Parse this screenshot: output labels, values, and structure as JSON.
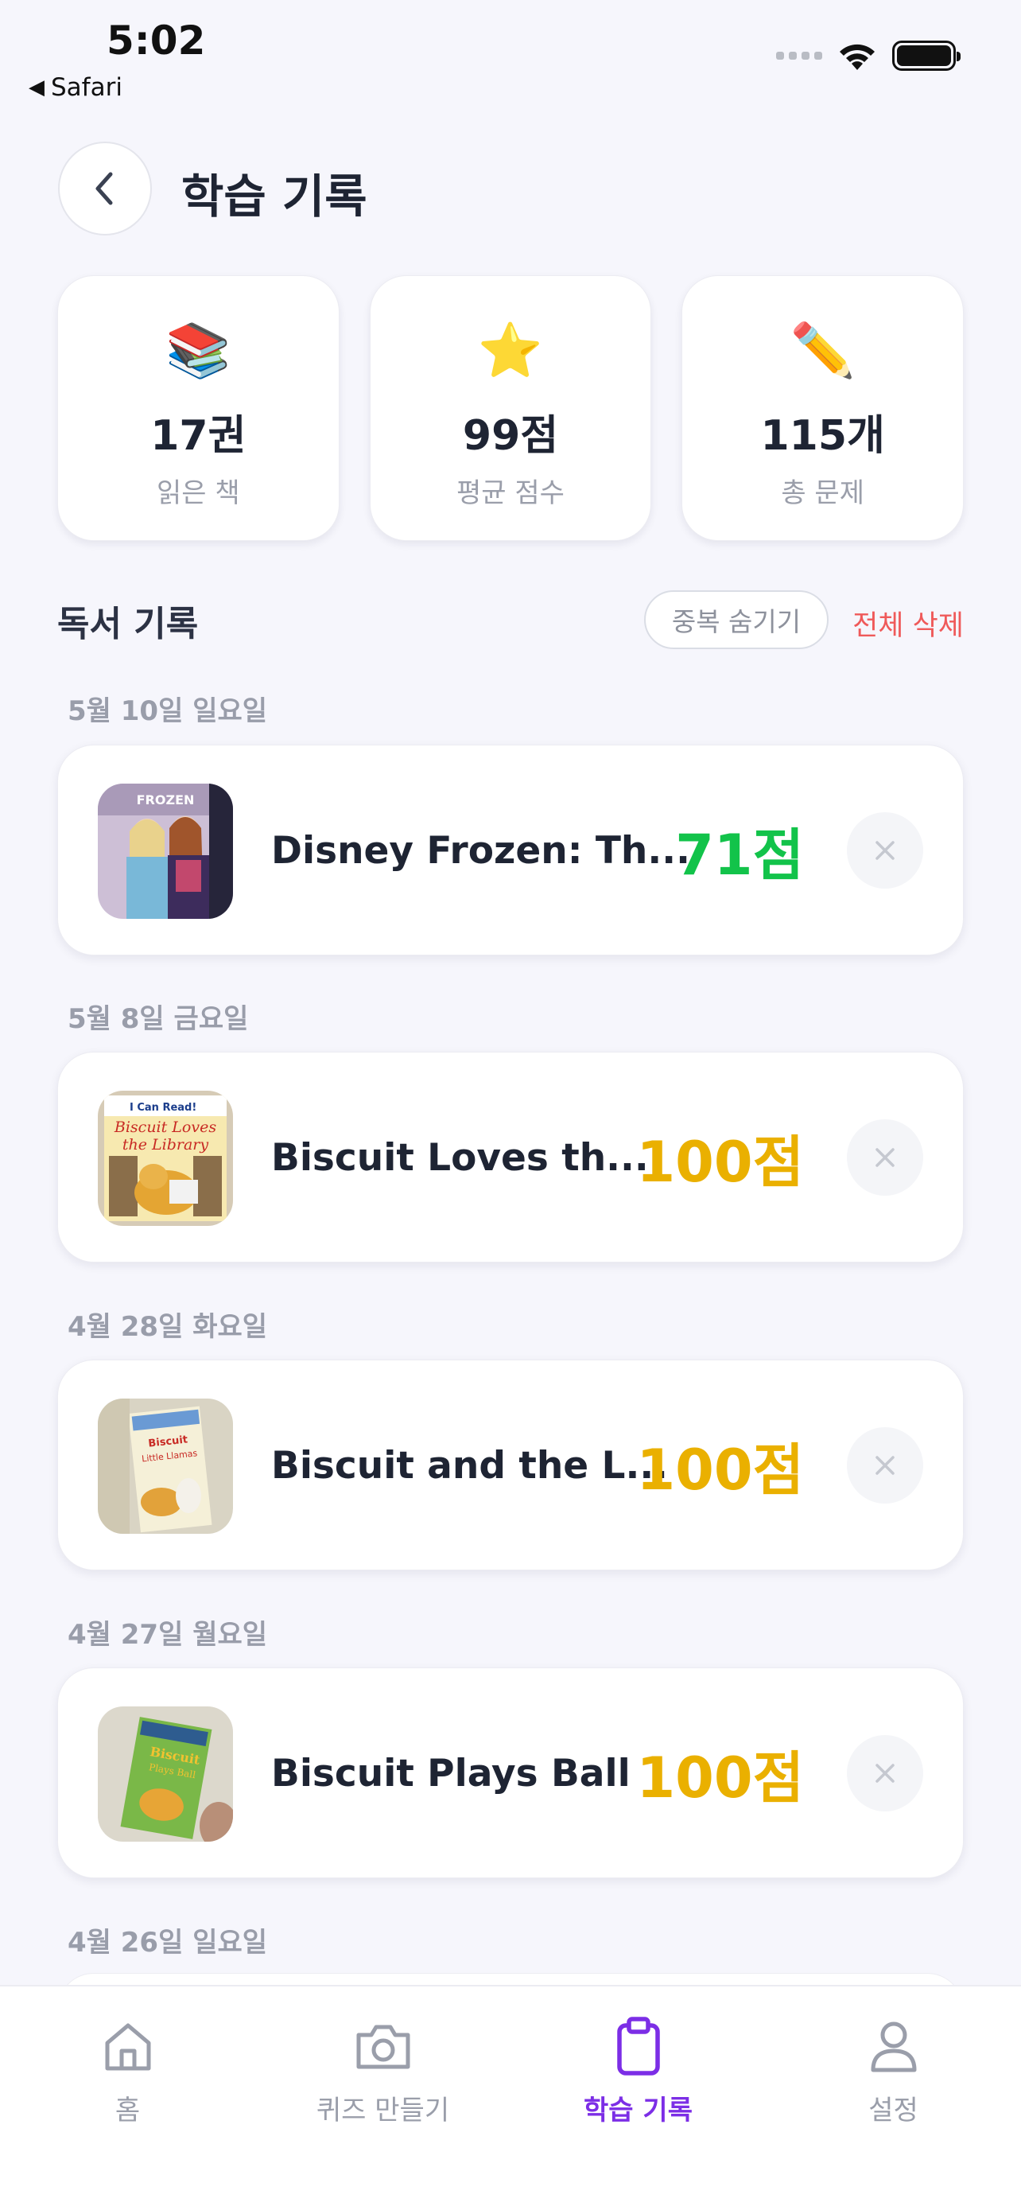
{
  "status_bar": {
    "time": "5:02",
    "back_app": "Safari"
  },
  "header": {
    "title": "학습 기록"
  },
  "stats": [
    {
      "icon": "books-icon",
      "emoji": "📚",
      "value": "17권",
      "label": "읽은 책"
    },
    {
      "icon": "star-icon",
      "emoji": "⭐",
      "value": "99점",
      "label": "평균 점수"
    },
    {
      "icon": "pencil-icon",
      "emoji": "✏️",
      "value": "115개",
      "label": "총 문제"
    }
  ],
  "section": {
    "title": "독서 기록",
    "hide_duplicates": "중복 숨기기",
    "delete_all": "전체 삭제"
  },
  "records": [
    {
      "date": "5월 10일 일요일",
      "title": "Disney Frozen: Th...",
      "score": "71점",
      "score_color": "#12c34a"
    },
    {
      "date": "5월 8일 금요일",
      "title": "Biscuit Loves th...",
      "score": "100점",
      "score_color": "#eab000"
    },
    {
      "date": "4월 28일 화요일",
      "title": "Biscuit and the L...",
      "score": "100점",
      "score_color": "#eab000"
    },
    {
      "date": "4월 27일 월요일",
      "title": "Biscuit Plays Ball",
      "score": "100점",
      "score_color": "#eab000"
    },
    {
      "date": "4월 26일 일요일"
    }
  ],
  "tabs": [
    {
      "label": "홈",
      "icon": "home-icon",
      "active": false
    },
    {
      "label": "퀴즈 만들기",
      "icon": "camera-icon",
      "active": false
    },
    {
      "label": "학습 기록",
      "icon": "clipboard-icon",
      "active": true
    },
    {
      "label": "설정",
      "icon": "person-icon",
      "active": false
    }
  ],
  "colors": {
    "accent": "#7c2ee6",
    "danger": "#ef5a5a",
    "score_high": "#eab000",
    "score_mid": "#12c34a"
  }
}
